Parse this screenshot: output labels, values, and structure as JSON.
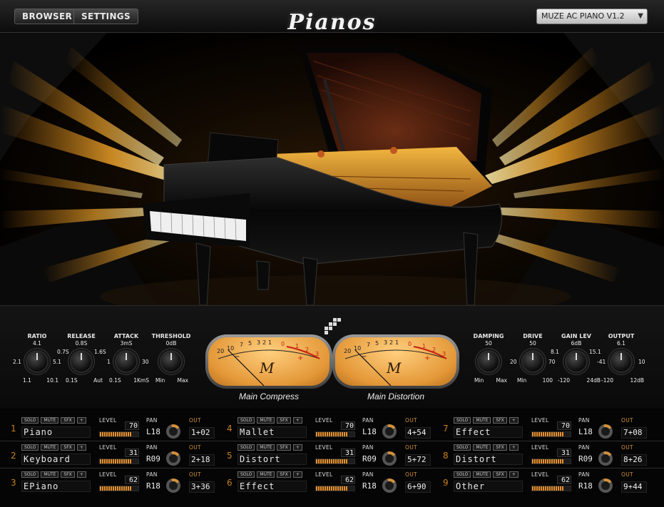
{
  "topbar": {
    "browser_label": "BROWSER",
    "settings_label": "SETTINGS",
    "logo": "Pianos",
    "preset": "MUZE AC PIANO V1.2"
  },
  "colors": {
    "accent": "#e8902c",
    "vu_face": "#f5b55a",
    "background": "#000000"
  },
  "left_knobs": [
    {
      "title": "RATIO",
      "value": "4.1",
      "left": "2.1",
      "right": "5.1",
      "min": "1.1",
      "max": "10.1"
    },
    {
      "title": "RELEASE",
      "value": "0.8S",
      "left": "0.7S",
      "right": "1.6S",
      "min": "0.1S",
      "max": "Aut"
    },
    {
      "title": "ATTACK",
      "value": "3mS",
      "left": "1",
      "right": "30",
      "min": "0.1S",
      "max": "1KmS"
    },
    {
      "title": "THRESHOLD",
      "value": "0dB",
      "left": "",
      "right": "",
      "min": "Min",
      "max": "Max"
    }
  ],
  "right_knobs": [
    {
      "title": "DAMPING",
      "value": "50",
      "left": "",
      "right": "",
      "min": "Min",
      "max": "Max"
    },
    {
      "title": "DRIVE",
      "value": "50",
      "left": "20",
      "right": "70",
      "min": "Min",
      "max": "100"
    },
    {
      "title": "GAIN LEV",
      "value": "6dB",
      "left": "8.1",
      "right": "15.1",
      "min": "-120",
      "max": "24dB"
    },
    {
      "title": "OUTPUT",
      "value": "6.1",
      "left": "-41",
      "right": "10",
      "min": "-120",
      "max": "12dB"
    }
  ],
  "meters": [
    {
      "caption": "Main Compress",
      "logo": "M",
      "scale": [
        "20",
        "10",
        "7",
        "5",
        "3",
        "2",
        "1",
        "0",
        "1",
        "2",
        "3"
      ],
      "minus": "−",
      "plus": "+"
    },
    {
      "caption": "Main Distortion",
      "logo": "M",
      "scale": [
        "20",
        "10",
        "7",
        "5",
        "3",
        "2",
        "1",
        "0",
        "1",
        "2",
        "3"
      ],
      "minus": "−",
      "plus": "+"
    }
  ],
  "channel_labels": {
    "solo": "SOLO",
    "mute": "MUTE",
    "sfx": "SFX",
    "plus": "+",
    "level": "LEVEL",
    "pan": "PAN",
    "out": "OUT"
  },
  "channels": [
    {
      "num": "1",
      "name": "Piano",
      "level": "70",
      "level_fraction": 0.82,
      "pan": "L18",
      "out": "1+02"
    },
    {
      "num": "2",
      "name": "Keyboard",
      "level": "31",
      "level_fraction": 0.82,
      "pan": "R09",
      "out": "2+18"
    },
    {
      "num": "3",
      "name": "EPiano",
      "level": "62",
      "level_fraction": 0.82,
      "pan": "R18",
      "out": "3+36"
    },
    {
      "num": "4",
      "name": "Mallet",
      "level": "70",
      "level_fraction": 0.82,
      "pan": "L18",
      "out": "4+54"
    },
    {
      "num": "5",
      "name": "Distort",
      "level": "31",
      "level_fraction": 0.82,
      "pan": "R09",
      "out": "5+72"
    },
    {
      "num": "6",
      "name": "Effect",
      "level": "62",
      "level_fraction": 0.82,
      "pan": "R18",
      "out": "6+90"
    },
    {
      "num": "7",
      "name": "Effect",
      "level": "70",
      "level_fraction": 0.82,
      "pan": "L18",
      "out": "7+08"
    },
    {
      "num": "8",
      "name": "Distort",
      "level": "31",
      "level_fraction": 0.82,
      "pan": "R09",
      "out": "8+26"
    },
    {
      "num": "9",
      "name": "Other",
      "level": "62",
      "level_fraction": 0.82,
      "pan": "R18",
      "out": "9+44"
    }
  ]
}
